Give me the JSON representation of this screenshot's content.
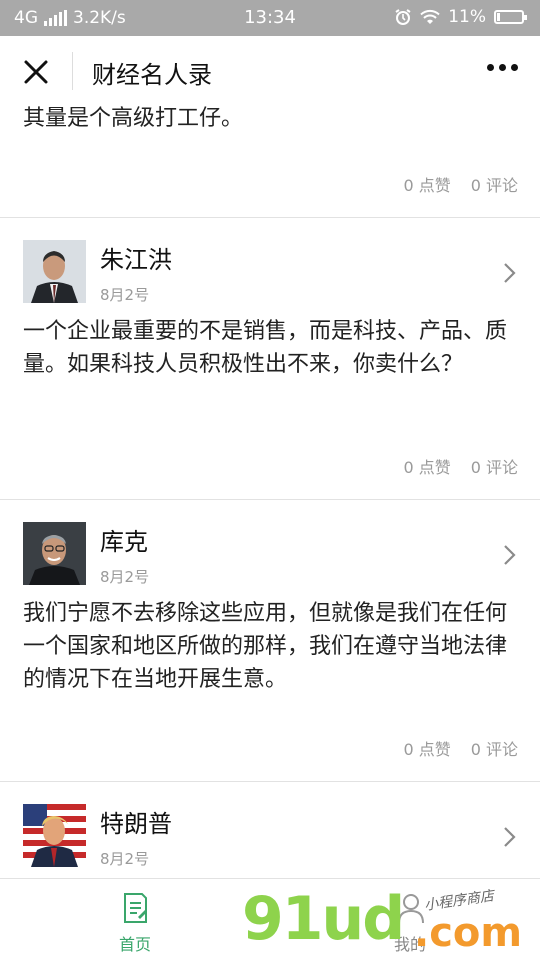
{
  "status_bar": {
    "network": "4G",
    "speed": "3.2K/s",
    "time": "13:34",
    "battery": "11%"
  },
  "nav": {
    "title": "财经名人录",
    "close_icon": "close-icon",
    "more_icon": "more-dots-icon"
  },
  "posts": [
    {
      "text": "其量是个高级打工仔。",
      "stats": {
        "likes": "0 点赞",
        "comments": "0 评论"
      }
    },
    {
      "author": "朱江洪",
      "date": "8月2号",
      "text": "一个企业最重要的不是销售，而是科技、产品、质量。如果科技人员积极性出不来，你卖什么？",
      "stats": {
        "likes": "0 点赞",
        "comments": "0 评论"
      }
    },
    {
      "author": "库克",
      "date": "8月2号",
      "text": "我们宁愿不去移除这些应用，但就像是我们在任何一个国家和地区所做的那样，我们在遵守当地法律的情况下在当地开展生意。",
      "stats": {
        "likes": "0 点赞",
        "comments": "0 评论"
      }
    },
    {
      "author": "特朗普",
      "date": "8月2号"
    }
  ],
  "tabbar": {
    "home": "首页",
    "mine": "我的"
  },
  "watermark": {
    "brand": "91ud",
    "suffix": ".com",
    "tagline": "小程序商店"
  },
  "colors": {
    "accent": "#3aa66b",
    "status_bar_bg": "#a9a9a9",
    "muted": "#9a9a9a"
  }
}
